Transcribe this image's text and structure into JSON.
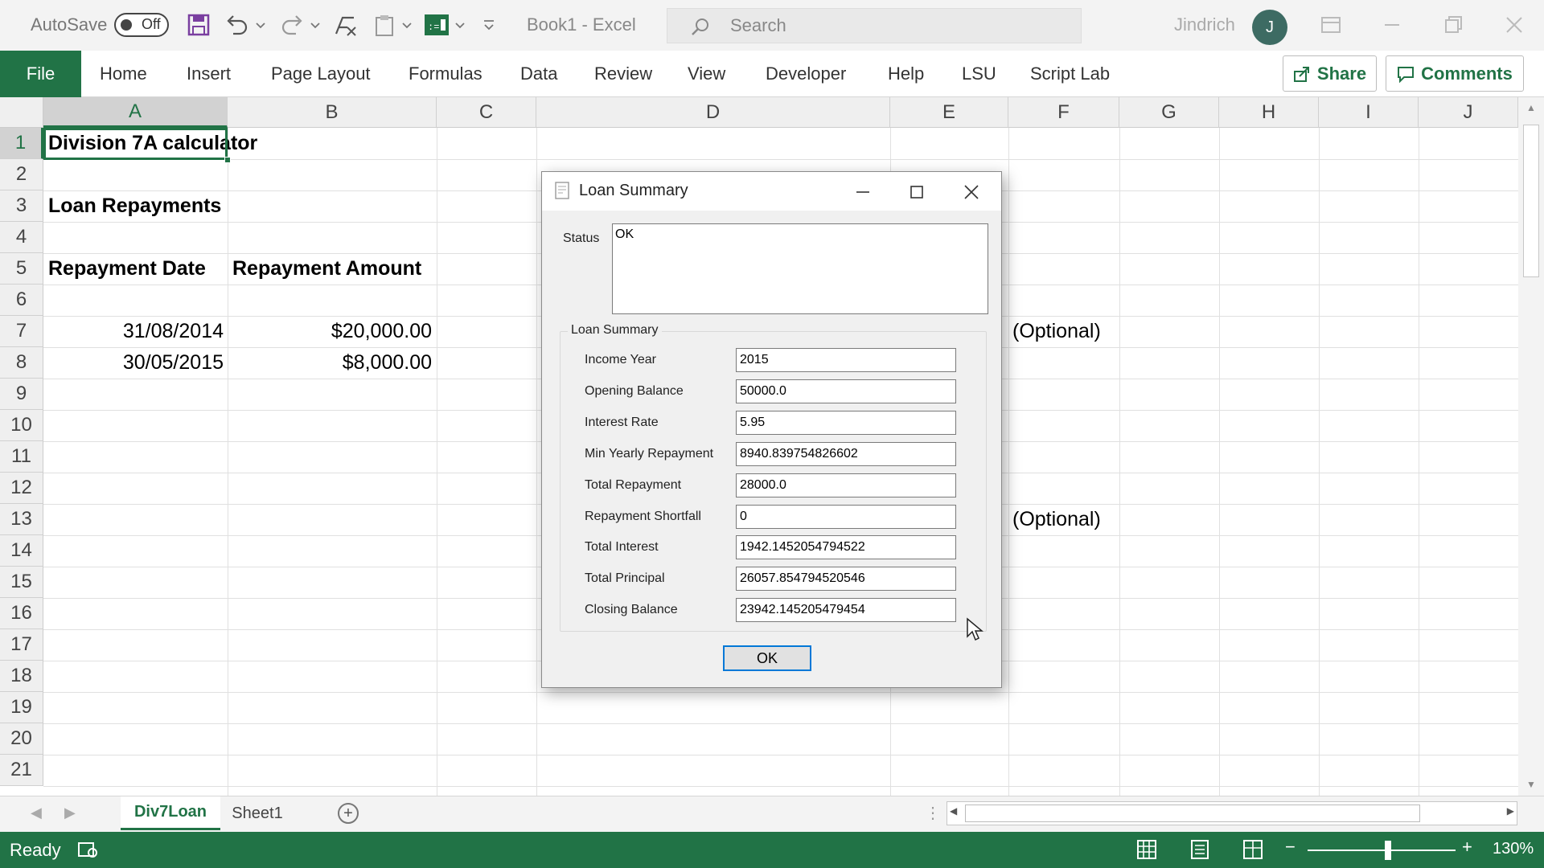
{
  "titlebar": {
    "autosave_label": "AutoSave",
    "autosave_state": "Off",
    "doc_title": "Book1  -  Excel",
    "search_placeholder": "Search",
    "user_name": "Jindrich",
    "user_initial": "J"
  },
  "ribbon": {
    "file": "File",
    "tabs": [
      "Home",
      "Insert",
      "Page Layout",
      "Formulas",
      "Data",
      "Review",
      "View",
      "Developer",
      "Help",
      "LSU",
      "Script Lab"
    ],
    "share": "Share",
    "comments": "Comments"
  },
  "grid": {
    "columns": [
      "A",
      "B",
      "C",
      "D",
      "E",
      "F",
      "G",
      "H",
      "I",
      "J"
    ],
    "rows": [
      "1",
      "2",
      "3",
      "4",
      "5",
      "6",
      "7",
      "8",
      "9",
      "10",
      "11",
      "12",
      "13",
      "14",
      "15",
      "16",
      "17",
      "18",
      "19",
      "20",
      "21"
    ],
    "cells": {
      "a1": "Division 7A calculator",
      "a3": "Loan Repayments",
      "a5": "Repayment Date",
      "b5": "Repayment Amount",
      "a7": "31/08/2014",
      "b7": "$20,000.00",
      "a8": "30/05/2015",
      "b8": "$8,000.00",
      "f7": "(Optional)",
      "f13": "(Optional)"
    }
  },
  "sheets": {
    "tabs": [
      "Div7Loan",
      "Sheet1"
    ],
    "active": "Div7Loan"
  },
  "statusbar": {
    "ready": "Ready",
    "zoom": "130%"
  },
  "dialog": {
    "title": "Loan Summary",
    "status_label": "Status",
    "status_value": "OK",
    "group_label": "Loan Summary",
    "fields": [
      {
        "label": "Income Year",
        "value": "2015"
      },
      {
        "label": "Opening Balance",
        "value": "50000.0"
      },
      {
        "label": "Interest Rate",
        "value": "5.95"
      },
      {
        "label": "Min Yearly Repayment",
        "value": "8940.839754826602"
      },
      {
        "label": "Total Repayment",
        "value": "28000.0"
      },
      {
        "label": "Repayment Shortfall",
        "value": "0"
      },
      {
        "label": "Total Interest",
        "value": "1942.1452054794522"
      },
      {
        "label": "Total Principal",
        "value": "26057.854794520546"
      },
      {
        "label": "Closing Balance",
        "value": "23942.145205479454"
      }
    ],
    "ok": "OK"
  },
  "colors": {
    "excel_green": "#217346",
    "focus_blue": "#0078d7"
  }
}
